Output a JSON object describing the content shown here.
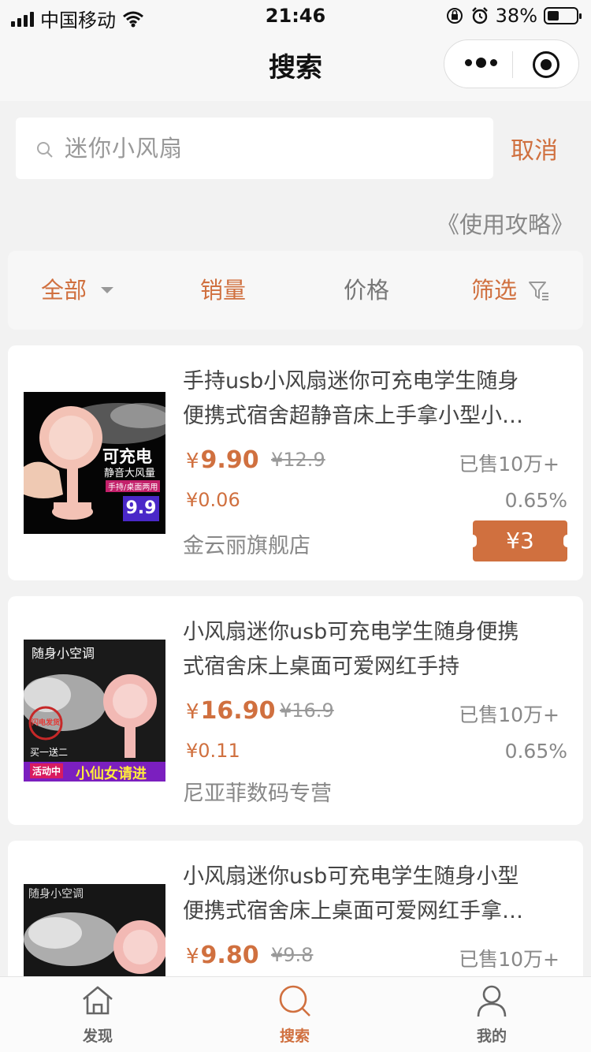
{
  "status_bar": {
    "carrier": "中国移动",
    "time": "21:46",
    "battery": "38%"
  },
  "nav": {
    "title": "搜索"
  },
  "search": {
    "value": "迷你小风扇",
    "cancel_label": "取消",
    "guide_label": "《使用攻略》"
  },
  "filters": {
    "all": "全部",
    "sales": "销量",
    "price": "价格",
    "filter": "筛选"
  },
  "products": [
    {
      "title_line1": "手持usb小风扇迷你可充电学生随身",
      "title_line2": "便携式宿舍超静音床上手拿小型小…",
      "price": "9.90",
      "original_price": "¥12.9",
      "sold": "已售10万+",
      "commission": "¥0.06",
      "rate": "0.65%",
      "shop": "金云丽旗舰店",
      "coupon": "¥3",
      "image_text": {
        "line1": "可充电",
        "line2": "静音大风量",
        "line3": "手持/桌面两用",
        "badge": "9.9"
      }
    },
    {
      "title_line1": "小风扇迷你usb可充电学生随身便携",
      "title_line2": "式宿舍床上桌面可爱网红手持",
      "price": "16.90",
      "original_price": "¥16.9",
      "sold": "已售10万+",
      "commission": "¥0.11",
      "rate": "0.65%",
      "shop": "尼亚菲数码专营",
      "image_text": {
        "top": "随身小空调",
        "stamp": "闪电发货",
        "promo": "买一送二",
        "tag": "活动中",
        "banner": "小仙女请进"
      }
    },
    {
      "title_line1": "小风扇迷你usb可充电学生随身小型",
      "title_line2": "便携式宿舍床上桌面可爱网红手拿…",
      "price": "9.80",
      "original_price": "¥9.8",
      "sold": "已售10万+",
      "image_text": {
        "top": "随身小空调"
      }
    }
  ],
  "currency_symbol": "¥",
  "tabbar": {
    "discover": "发现",
    "search": "搜索",
    "mine": "我的"
  },
  "colors": {
    "accent": "#d0703f",
    "background": "#f2f2f2"
  }
}
